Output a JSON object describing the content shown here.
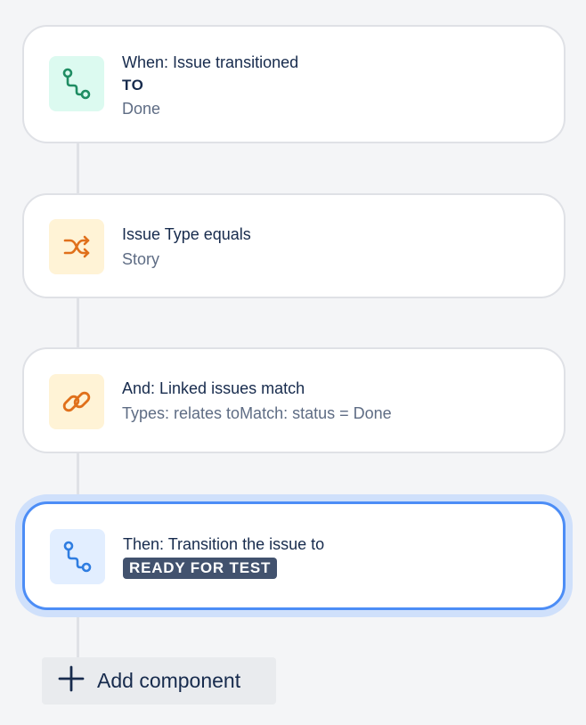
{
  "components": [
    {
      "title": "When: Issue transitioned",
      "emphasis": "TO",
      "detail": "Done",
      "icon": "transition-icon",
      "icon_color": "#1f8d63",
      "tile_color": "#dcfaf0"
    },
    {
      "title": "Issue Type equals",
      "detail": "Story",
      "icon": "shuffle-icon",
      "icon_color": "#e0701b",
      "tile_color": "#fff3d6"
    },
    {
      "title": "And: Linked issues match",
      "detail": "Types: relates toMatch: status = Done",
      "icon": "link-icon",
      "icon_color": "#e0701b",
      "tile_color": "#fff3d6"
    },
    {
      "title": "Then: Transition the issue to",
      "status_lozenge": "READY FOR TEST",
      "icon": "transition-icon",
      "icon_color": "#2f7de1",
      "tile_color": "#e2eeff",
      "selected": true
    }
  ],
  "add_component": {
    "label": "Add component",
    "icon": "plus-icon"
  }
}
